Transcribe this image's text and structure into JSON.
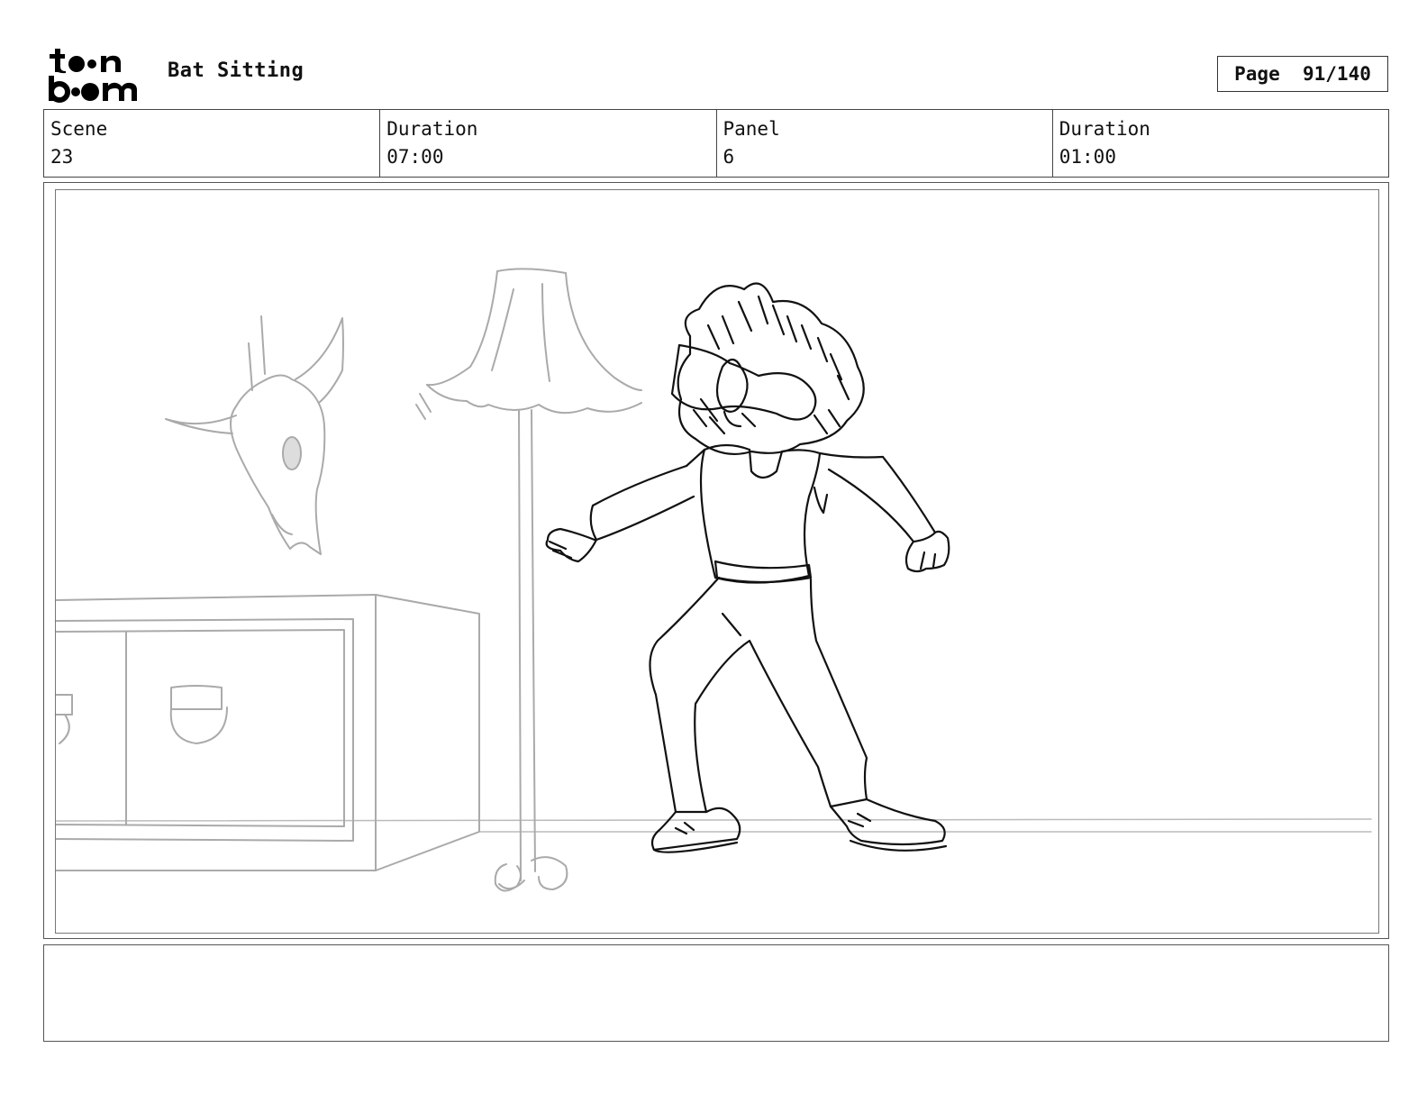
{
  "logo": {
    "name": "toon boom logo"
  },
  "header": {
    "project_title": "Bat Sitting",
    "page_label": "Page  91/140"
  },
  "info": {
    "scene_label": "Scene",
    "scene_value": "23",
    "scene_duration_label": "Duration",
    "scene_duration_value": "07:00",
    "panel_label": "Panel",
    "panel_value": "6",
    "panel_duration_label": "Duration",
    "panel_duration_value": "01:00"
  },
  "notes": {
    "text": ""
  },
  "colors": {
    "sketch_dark": "#111111",
    "sketch_light": "#aaaaaa",
    "border": "#555555"
  }
}
